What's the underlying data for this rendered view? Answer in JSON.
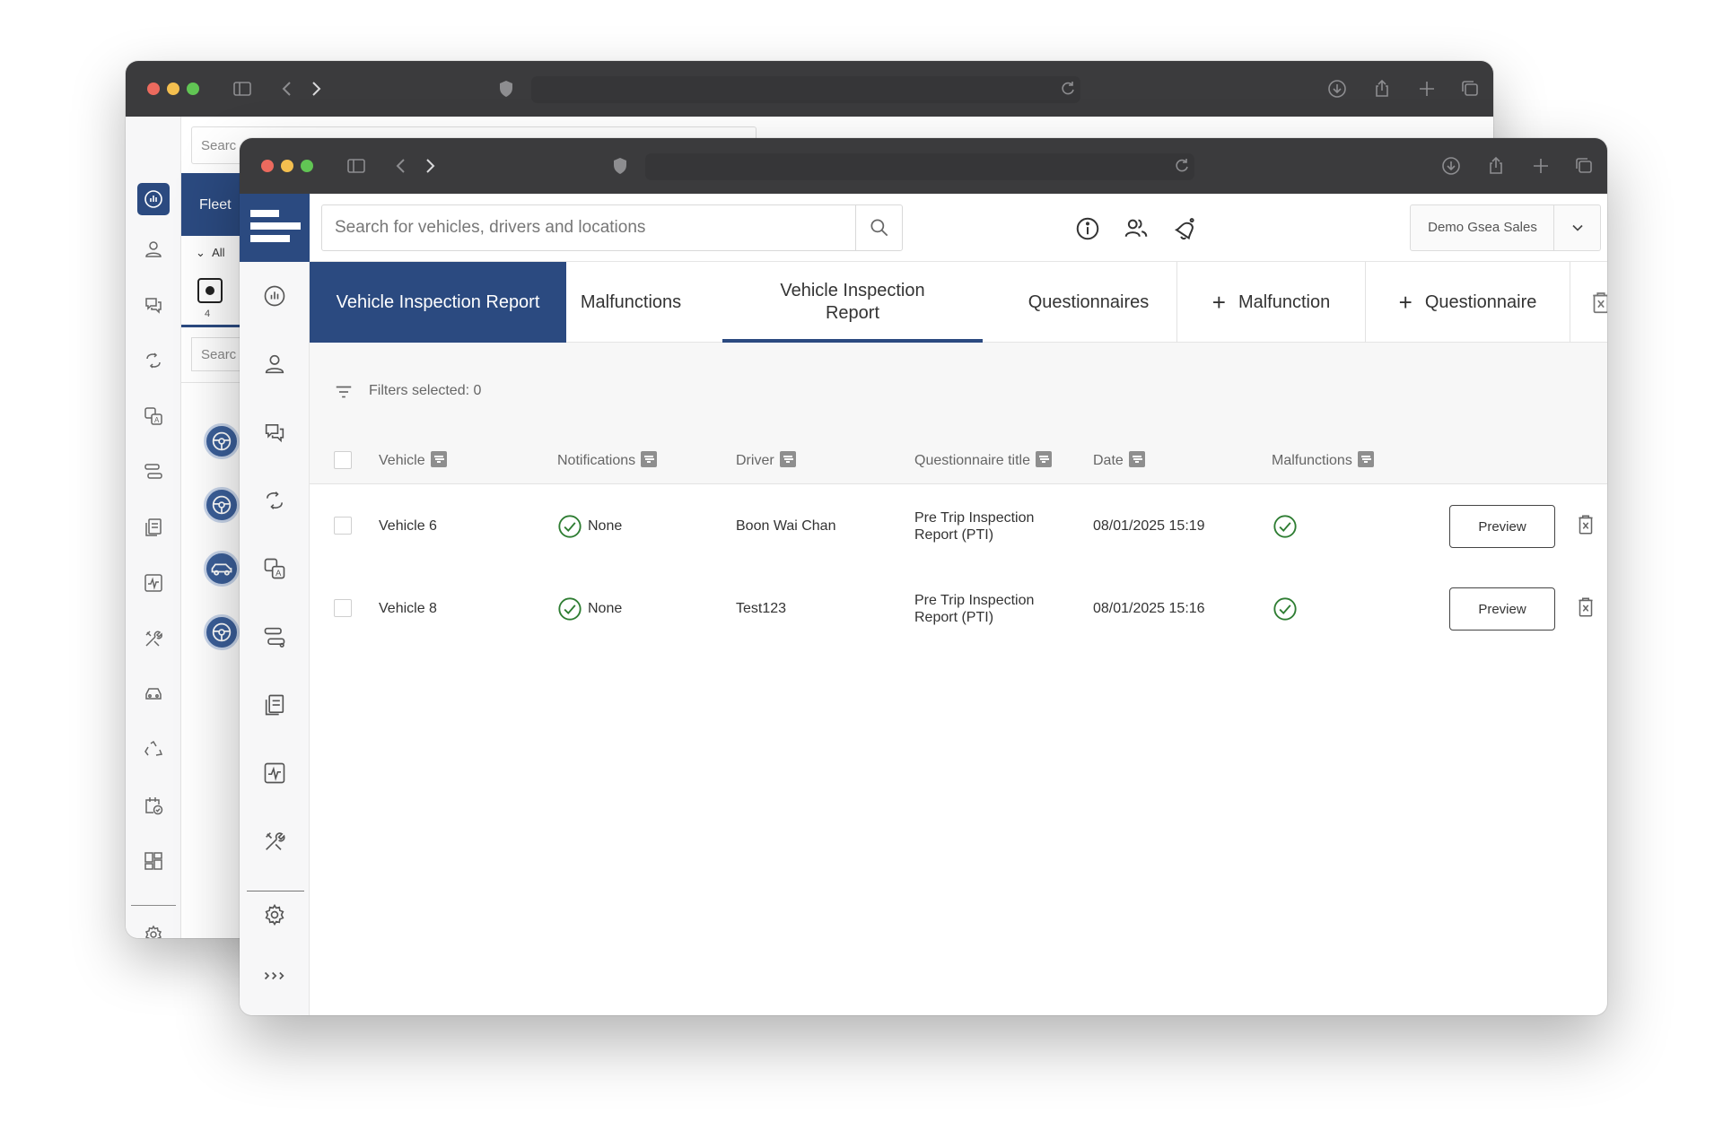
{
  "back_window": {
    "search_partial": "Searc",
    "fleet_tab_partial": "Fleet",
    "all_filter_partial": "All",
    "tile_count": "4",
    "search2_partial": "Searc",
    "sidebar_icons": [
      "dashboard-icon",
      "person-icon",
      "chat-icon",
      "route-icon",
      "translate-icon",
      "transfer-icon",
      "documents-icon",
      "activity-icon",
      "tools-icon",
      "vehicle-icon",
      "recycle-icon",
      "calendar-check-icon",
      "layout-icon",
      "settings-icon"
    ]
  },
  "search": {
    "placeholder": "Search for vehicles, drivers and locations"
  },
  "account": {
    "name": "Demo Gsea Sales"
  },
  "sidebar_icons": [
    "dashboard-icon",
    "person-icon",
    "chat-icon",
    "route-icon",
    "translate-icon",
    "transfer-icon",
    "documents-icon",
    "activity-icon",
    "tools-icon",
    "settings-icon",
    "expand-icon"
  ],
  "tabs": [
    {
      "label": "Vehicle Inspection Report",
      "state": "active"
    },
    {
      "label": "Malfunctions"
    },
    {
      "label": "Vehicle Inspection Report",
      "state": "underlined"
    },
    {
      "label": "Questionnaires"
    },
    {
      "label": "Malfunction",
      "icon": "plus-icon"
    },
    {
      "label": "Questionnaire",
      "icon": "plus-icon"
    }
  ],
  "filters": {
    "label": "Filters selected: 0"
  },
  "table": {
    "columns": [
      "Vehicle",
      "Notifications",
      "Driver",
      "Questionnaire title",
      "Date",
      "Malfunctions"
    ],
    "rows": [
      {
        "vehicle": "Vehicle 6",
        "notifications": "None",
        "driver": "Boon Wai Chan",
        "questionnaire": "Pre Trip Inspection Report (PTI)",
        "date": "08/01/2025 15:19",
        "malfunctions": "ok",
        "action": "Preview"
      },
      {
        "vehicle": "Vehicle 8",
        "notifications": "None",
        "driver": "Test123",
        "questionnaire": "Pre Trip Inspection Report (PTI)",
        "date": "08/01/2025 15:16",
        "malfunctions": "ok",
        "action": "Preview"
      }
    ]
  },
  "colors": {
    "brand": "#2b4a80",
    "ok": "#2e7d32",
    "chrome": "#3b3b3d"
  }
}
